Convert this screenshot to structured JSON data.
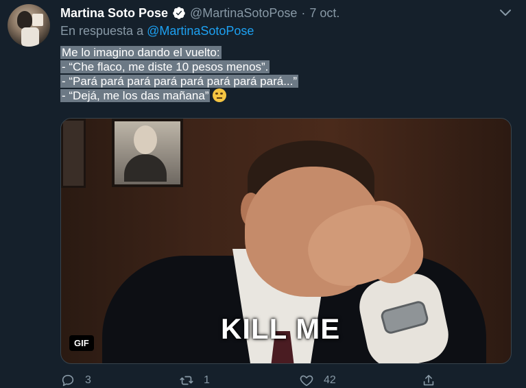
{
  "author": {
    "name": "Martina Soto Pose",
    "handle": "@MartinaSotoPose",
    "date": "7 oct.",
    "separator": "·"
  },
  "reply": {
    "prefix": "En respuesta a",
    "mention": "@MartinaSotoPose"
  },
  "tweet": {
    "lines": [
      "Me lo imagino dando el vuelto:",
      "- “Che flaco, me diste 10 pesos menos”.",
      "- “Pará pará pará pará pará pará pará pará...”",
      "- “Dejá, me los das mañana”"
    ],
    "emoji": "rolling-eyes-emoji"
  },
  "media": {
    "caption": "KILL ME",
    "badge": "GIF"
  },
  "actions": {
    "reply_count": "3",
    "retweet_count": "1",
    "like_count": "42"
  },
  "colors": {
    "background": "#15202b",
    "text": "#ffffff",
    "secondary": "#8899a6",
    "link": "#1da1f2",
    "highlight": "#6c7985"
  }
}
